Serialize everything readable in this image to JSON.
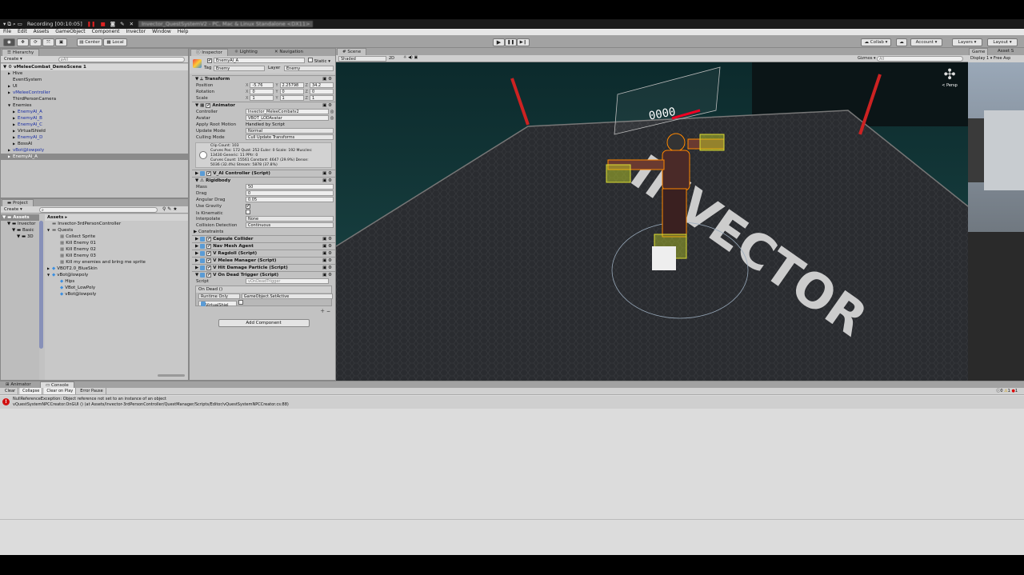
{
  "recorder": {
    "label": "Recording [00:10:05]",
    "window_title": "Invector_QuestSystemV2 - PC, Mac & Linux Standalone <DX11>"
  },
  "menu": [
    "File",
    "Edit",
    "Assets",
    "GameObject",
    "Component",
    "Invector",
    "Window",
    "Help"
  ],
  "toolbar": {
    "center": "Center",
    "local": "Local",
    "collab": "Collab",
    "account": "Account",
    "layers": "Layers",
    "layout": "Layout"
  },
  "hierarchy": {
    "tab": "Hierarchy",
    "create": "Create",
    "search_placeholder": "All",
    "scene": "vMeleeCombat_DemoScene 1",
    "items": [
      {
        "label": "Hive",
        "indent": 1,
        "arrow": "▶",
        "blue": false
      },
      {
        "label": "EventSystem",
        "indent": 1,
        "arrow": "",
        "blue": false
      },
      {
        "label": "UI",
        "indent": 1,
        "arrow": "▶",
        "blue": false
      },
      {
        "label": "vMeleeController",
        "indent": 1,
        "arrow": "▶",
        "blue": true
      },
      {
        "label": "ThirdPersonCamera",
        "indent": 1,
        "arrow": "",
        "blue": false
      },
      {
        "label": "Enemies",
        "indent": 1,
        "arrow": "▼",
        "blue": false
      },
      {
        "label": "EnemyAI_A",
        "indent": 2,
        "arrow": "▶",
        "blue": true
      },
      {
        "label": "EnemyAI_B",
        "indent": 2,
        "arrow": "▶",
        "blue": true
      },
      {
        "label": "EnemyAI_C",
        "indent": 2,
        "arrow": "▶",
        "blue": true
      },
      {
        "label": "VirtualShield",
        "indent": 2,
        "arrow": "▶",
        "blue": false
      },
      {
        "label": "EnemyAI_D",
        "indent": 2,
        "arrow": "▶",
        "blue": true
      },
      {
        "label": "BossAI",
        "indent": 2,
        "arrow": "▶",
        "blue": false
      },
      {
        "label": "vBot@lowpoly",
        "indent": 1,
        "arrow": "▶",
        "blue": true
      },
      {
        "label": "EnemyAI_A",
        "indent": 1,
        "arrow": "▶",
        "blue": false,
        "selected": true
      }
    ]
  },
  "project": {
    "tab": "Project",
    "create": "Create",
    "breadcrumb": "Assets ▸",
    "tree": [
      "Assets",
      "Invector",
      "Basic",
      "3D"
    ],
    "items": [
      {
        "label": "Invector-3rdPersonController",
        "indent": 0,
        "icon": "folder"
      },
      {
        "label": "Quests",
        "indent": 0,
        "icon": "folder",
        "arrow": "▼"
      },
      {
        "label": "Collect Sprite",
        "indent": 1,
        "icon": "asset"
      },
      {
        "label": "Kill Enemy 01",
        "indent": 1,
        "icon": "asset"
      },
      {
        "label": "Kill Enemy 02",
        "indent": 1,
        "icon": "asset"
      },
      {
        "label": "Kill Enemy 03",
        "indent": 1,
        "icon": "asset"
      },
      {
        "label": "Kill my enemies and bring me sprite",
        "indent": 1,
        "icon": "asset"
      },
      {
        "label": "VBOT2.0_BlueSkin",
        "indent": 0,
        "icon": "prefab",
        "arrow": "▶"
      },
      {
        "label": "vBot@lowpoly",
        "indent": 0,
        "icon": "prefab",
        "arrow": "▼"
      },
      {
        "label": "Hips",
        "indent": 1,
        "icon": "prefab"
      },
      {
        "label": "VBot_LowPoly",
        "indent": 1,
        "icon": "prefab"
      },
      {
        "label": "vBot@lowpoly",
        "indent": 1,
        "icon": "prefab"
      }
    ]
  },
  "inspector": {
    "tabs": [
      "Inspector",
      "Lighting",
      "Navigation"
    ],
    "name": "EnemyAI_A",
    "static": "Static",
    "tag_label": "Tag",
    "tag": "Enemy",
    "layer_label": "Layer",
    "layer": "Enemy",
    "transform": {
      "title": "Transform",
      "rows": [
        {
          "label": "Position",
          "x": "-5.76",
          "y": "2.25798",
          "z": "34.2"
        },
        {
          "label": "Rotation",
          "x": "0",
          "y": "0",
          "z": "0"
        },
        {
          "label": "Scale",
          "x": "1",
          "y": "1",
          "z": "1"
        }
      ]
    },
    "animator": {
      "title": "Animator",
      "controller_label": "Controller",
      "controller": "Invector_MeleeCombatv2",
      "avatar_label": "Avatar",
      "avatar": "VBOT_LODAvatar",
      "root_label": "Apply Root Motion",
      "root": "Handled by Script",
      "update_label": "Update Mode",
      "update": "Normal",
      "culling_label": "Culling Mode",
      "culling": "Cull Update Transforms",
      "info": [
        "Clip Count: 103",
        "Curves Pos: 172 Quat: 252 Euler: 0 Scale: 192 Muscles:",
        "13430 Generic: 11 PPtr: 0",
        "Curves Count: 15561 Constant: 4647 (29.9%) Dense:",
        "5036 (32.4%) Stream: 5878 (37.8%)"
      ]
    },
    "ai_controller": "V_AI Controller (Script)",
    "rigidbody": {
      "title": "Rigidbody",
      "mass_label": "Mass",
      "mass": "50",
      "drag_label": "Drag",
      "drag": "0",
      "angular_label": "Angular Drag",
      "angular": "0.05",
      "gravity_label": "Use Gravity",
      "use_gravity": true,
      "kinematic_label": "Is Kinematic",
      "is_kinematic": false,
      "interp_label": "Interpolate",
      "interpolate": "None",
      "collision_label": "Collision Detection",
      "collision": "Continuous",
      "constraints": "Constraints"
    },
    "components": [
      "Capsule Collider",
      "Nav Mesh Agent",
      "V Ragdoll (Script)",
      "V Melee Manager (Script)",
      "V Hit Damage Particle (Script)",
      "V On Dead Trigger (Script)"
    ],
    "dead_trigger": {
      "script_label": "Script",
      "script": "vOnDeadTrigger",
      "event": "On Dead ()",
      "runtime": "Runtime Only",
      "function": "GameObject.SetActive",
      "object": "VirtualShiel"
    },
    "add_component": "Add Component"
  },
  "scene": {
    "tab": "Scene",
    "shading": "Shaded",
    "mode_2d": "2D",
    "gizmos": "Gizmos",
    "search": "All",
    "persp": "< Persp",
    "scoreboard": "0000",
    "floor_text": "INVECTOR"
  },
  "game": {
    "tab": "Game",
    "asset_tab": "Asset S",
    "display": "Display 1",
    "aspect": "Free Asp"
  },
  "console": {
    "tabs": [
      "Animator",
      "Console"
    ],
    "buttons": [
      "Clear",
      "Collapse",
      "Clear on Play",
      "Error Pause"
    ],
    "counts": {
      "log": "0",
      "warn": "1",
      "error": "1"
    },
    "message": [
      "NullReferenceException: Object reference not set to an instance of an object",
      "vQuestSystemNPCCreator.OnGUI () (at Assets/Invector-3rdPersonController/QuestManager/Scripts/Editor/vQuestSystemNPCCreator.cs:88)"
    ]
  }
}
